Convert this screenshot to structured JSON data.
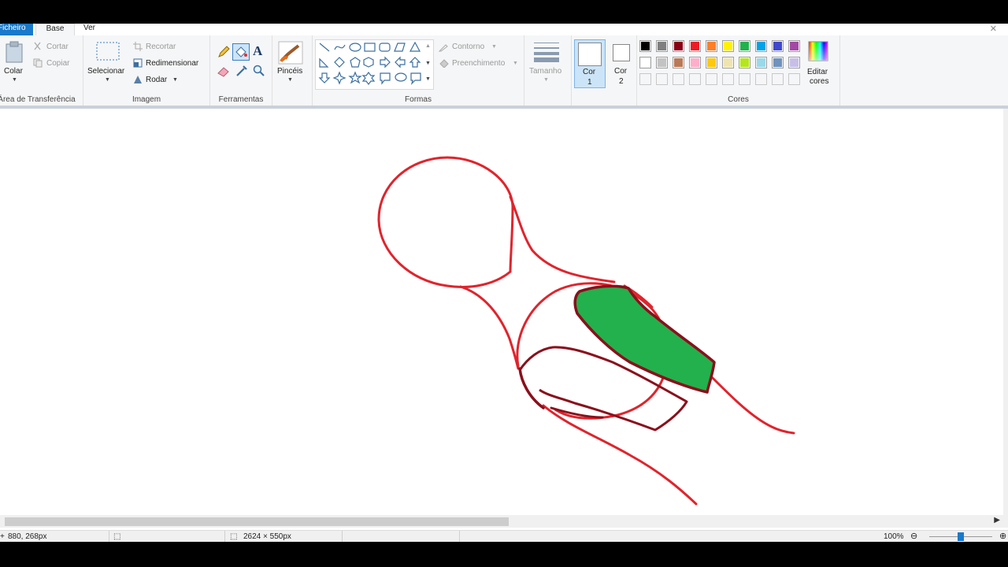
{
  "tabs": {
    "file": "Ficheiro",
    "home": "Base",
    "view": "Ver"
  },
  "clipboard": {
    "paste": "Colar",
    "cut": "Cortar",
    "copy": "Copiar",
    "title": "Área de Transferência"
  },
  "image": {
    "select": "Selecionar",
    "crop": "Recortar",
    "resize": "Redimensionar",
    "rotate": "Rodar",
    "title": "Imagem"
  },
  "tools": {
    "title": "Ferramentas"
  },
  "brushes": {
    "label": "Pincéis"
  },
  "shapes": {
    "outline": "Contorno",
    "fill": "Preenchimento",
    "title": "Formas"
  },
  "size": {
    "label": "Tamanho"
  },
  "color1": {
    "label": "Cor",
    "num": "1"
  },
  "color2": {
    "label": "Cor",
    "num": "2"
  },
  "colors": {
    "title": "Cores",
    "edit_line1": "Editar",
    "edit_line2": "cores",
    "row1": [
      "#000000",
      "#7f7f7f",
      "#880015",
      "#ed1c24",
      "#ff7f27",
      "#fff200",
      "#22b14c",
      "#00a2e8",
      "#3f48cc",
      "#a349a4"
    ],
    "row2": [
      "#ffffff",
      "#c3c3c3",
      "#b97a57",
      "#ffaec9",
      "#ffc90e",
      "#efe4b0",
      "#b5e61d",
      "#99d9ea",
      "#7092be",
      "#c8bfe7"
    ]
  },
  "status": {
    "cursor": "880, 268px",
    "dimensions": "2624 × 550px",
    "zoom": "100%"
  },
  "accent": "#1979ca"
}
